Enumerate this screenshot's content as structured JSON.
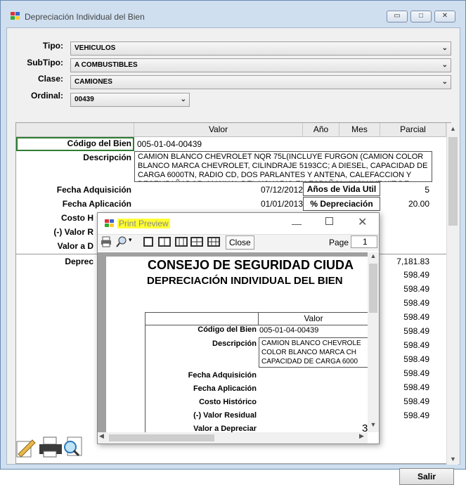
{
  "window": {
    "title": "Depreciación Individual del Bien",
    "min_glyph": "▭",
    "max_glyph": "□",
    "close_glyph": "✕"
  },
  "form": {
    "tipo_label": "Tipo:",
    "tipo_value": "VEHICULOS",
    "subtipo_label": "SubTipo:",
    "subtipo_value": "A COMBUSTIBLES",
    "clase_label": "Clase:",
    "clase_value": "CAMIONES",
    "ordinal_label": "Ordinal:",
    "ordinal_value": "00439"
  },
  "grid": {
    "headers": {
      "valor": "Valor",
      "ano": "Año",
      "mes": "Mes",
      "parcial": "Parcial"
    },
    "codigo_label": "Código del Bien",
    "codigo_value": "005-01-04-00439",
    "descripcion_label": "Descripción",
    "descripcion_value": "CAMION BLANCO CHEVROLET NQR 75L(INCLUYE FURGON (CAMION COLOR BLANCO  MARCA CHEVROLET, CILINDRAJE 5193CC; A DIESEL, CAPACIDAD DE CARGA 6000TN, RADIO CD, DOS PARLANTES Y ANTENA, CALEFACCION Y DESEMPAÑADOR, MANUAL DEL USUARIO EN ESPAÑOL, INCLUYE KIT DE",
    "fecha_adq_label": "Fecha Adquisición",
    "fecha_adq_value": "07/12/2012",
    "fecha_apl_label": "Fecha Aplicación",
    "fecha_apl_value": "01/01/2013",
    "anos_vida_label": "Años de Vida Util",
    "anos_vida_value": "5",
    "pct_dep_label": "% Depreciación",
    "pct_dep_value": "20.00",
    "costo_label": "Costo H",
    "valor_res_label": "(-) Valor R",
    "valor_dep_label": "Valor a D",
    "deprec_label": "Deprec",
    "parcial_values": [
      "7,181.83",
      "598.49",
      "598.49",
      "598.49",
      "598.49",
      "598.49",
      "598.49",
      "598.49",
      "598.49",
      "598.49",
      "598.49",
      "598.49"
    ]
  },
  "preview": {
    "title": "Print Preview",
    "close_label": "Close",
    "page_label": "Page",
    "page_value": "1",
    "report_title": "CONSEJO DE SEGURIDAD CIUDA",
    "report_subtitle": "DEPRECIACIÓN INDIVIDUAL DEL BIEN",
    "col_valor": "Valor",
    "codigo_label": "Código del Bien",
    "codigo_value": "005-01-04-00439",
    "descripcion_label": "Descripción",
    "descripcion_value": "CAMION BLANCO CHEVROLE COLOR BLANCO  MARCA CH CAPACIDAD DE CARGA 6000",
    "fecha_adq_label": "Fecha Adquisición",
    "fecha_apl_label": "Fecha Aplicación",
    "costo_label": "Costo Histórico",
    "valor_res_label": "(-) Valor Residual",
    "valor_dep_label": "Valor a Depreciar",
    "valor_dep_partial": "3"
  },
  "buttons": {
    "salir": "Salir"
  }
}
